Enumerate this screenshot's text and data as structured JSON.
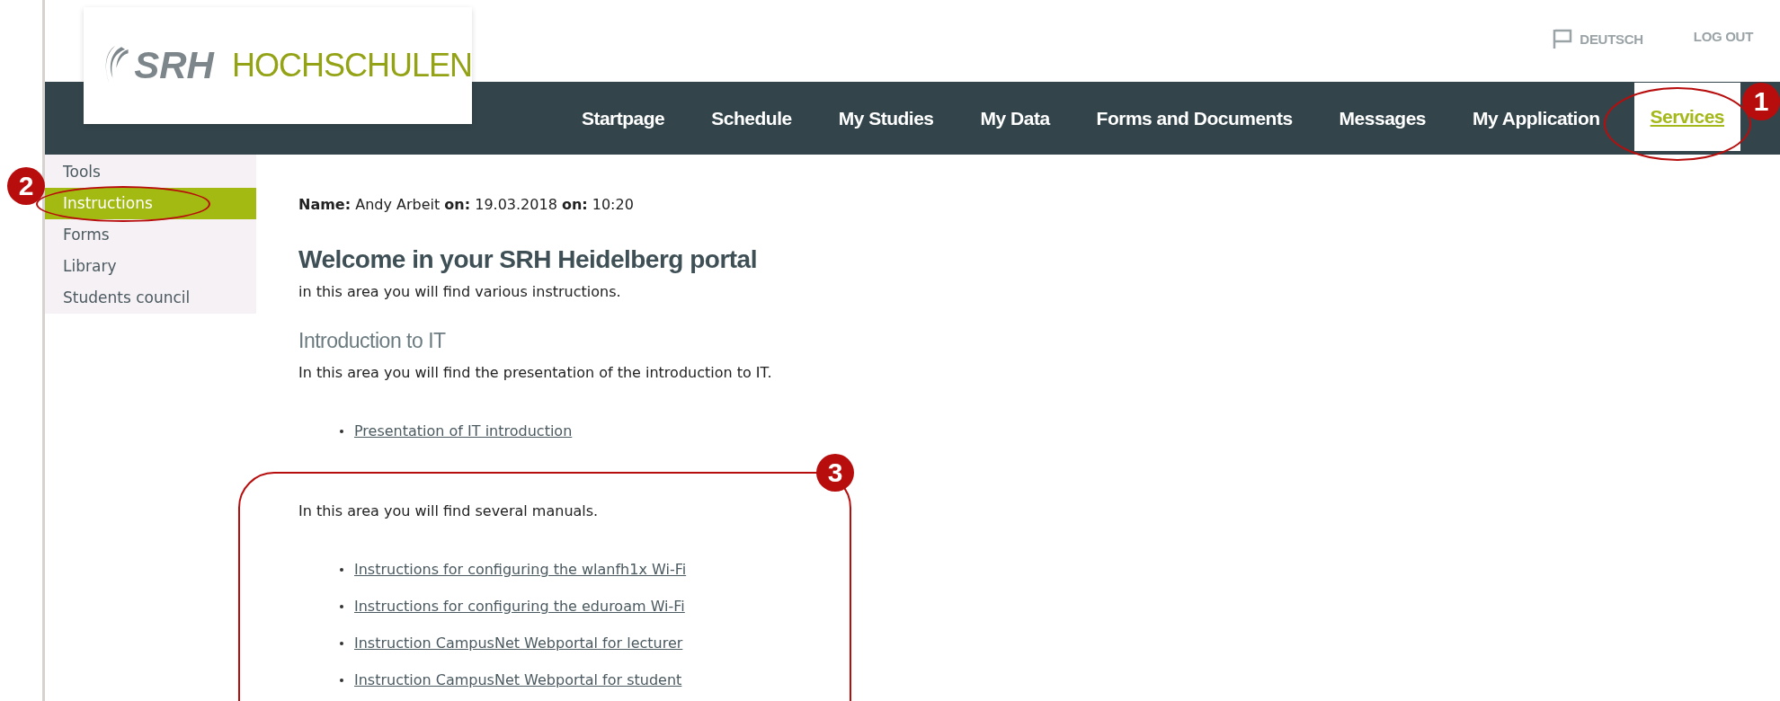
{
  "logo": {
    "mark": "SRH",
    "text": "HOCHSCHULEN"
  },
  "top_links": [
    {
      "kind": "language",
      "label": "DEUTSCH"
    },
    {
      "kind": "plain",
      "label": "LOG OUT"
    }
  ],
  "nav": [
    {
      "label": "Startpage",
      "selected": false
    },
    {
      "label": "Schedule",
      "selected": false
    },
    {
      "label": "My Studies",
      "selected": false
    },
    {
      "label": "My Data",
      "selected": false
    },
    {
      "label": "Forms and Documents",
      "selected": false
    },
    {
      "label": "Messages",
      "selected": false
    },
    {
      "label": "My Application",
      "selected": false
    },
    {
      "label": "Services",
      "selected": true
    }
  ],
  "sidebar": [
    {
      "label": "Tools",
      "selected": false
    },
    {
      "label": "Instructions",
      "selected": true
    },
    {
      "label": "Forms",
      "selected": false
    },
    {
      "label": "Library",
      "selected": false
    },
    {
      "label": "Students council",
      "selected": false
    }
  ],
  "user_line": "**Name:** Andy Arbeit **on:** 19.03.2018 **on:** 10:20",
  "heading": "Welcome in your SRH Heidelberg portal",
  "intro": "in this area you will find various instructions.",
  "sections": [
    {
      "title": "Introduction to IT",
      "text": "In this area you will find the presentation of the introduction to IT.",
      "links": [
        "Presentation of IT introduction"
      ]
    },
    {
      "text": "In this area you will find several manuals.",
      "links": [
        "Instructions for configuring the wlanfh1x Wi-Fi",
        "Instructions for configuring the eduroam Wi-Fi",
        "Instruction CampusNet Webportal for lecturer",
        "Instruction CampusNet Webportal for student"
      ]
    }
  ],
  "callouts": [
    {
      "number": "1"
    },
    {
      "number": "2"
    },
    {
      "number": "3"
    }
  ]
}
